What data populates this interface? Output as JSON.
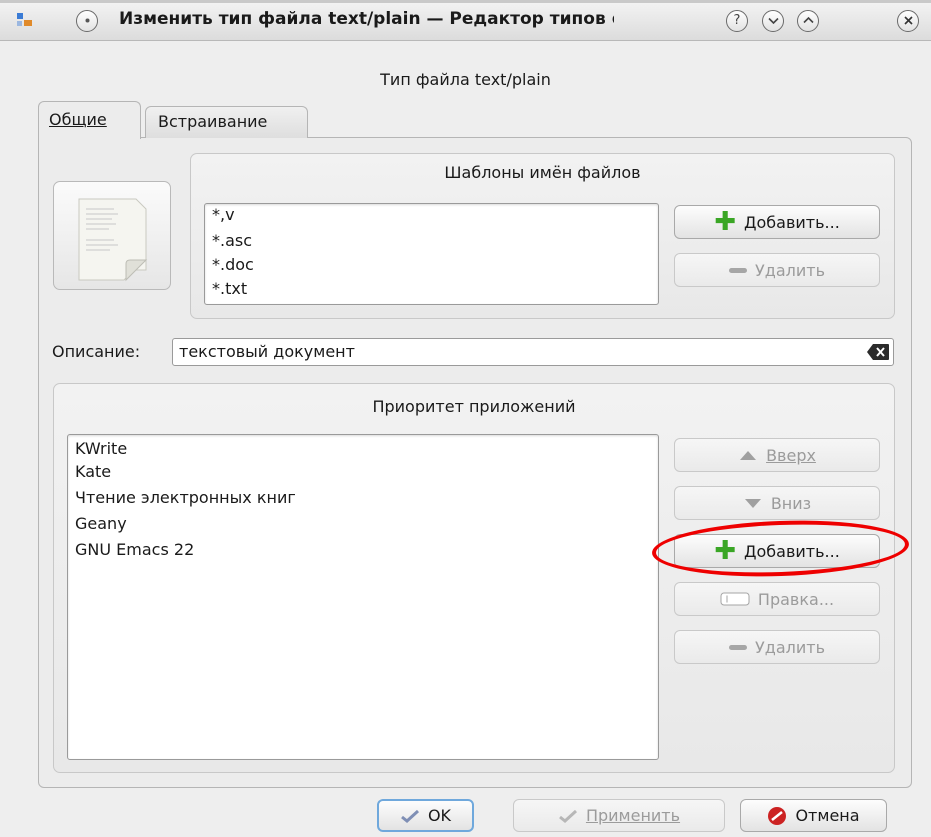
{
  "window": {
    "title": "Изменить тип файла text/plain — Редактор типов файлов",
    "close_icon": "close-icon",
    "help_icon": "help-icon",
    "minimize_icon": "chevron-down-icon",
    "maximize_icon": "chevron-up-icon"
  },
  "header": {
    "file_type_label": "Тип файла text/plain"
  },
  "tabs": [
    {
      "label": "Общие",
      "mnemonic": "О",
      "active": true
    },
    {
      "label": "Встраивание",
      "mnemonic": "В",
      "active": false
    }
  ],
  "patterns": {
    "title": "Шаблоны имён файлов",
    "items": [
      "*,v",
      "*.asc",
      "*.doc",
      "*.txt"
    ],
    "add_label": "Добавить...",
    "remove_label": "Удалить"
  },
  "description": {
    "label": "Описание:",
    "value": "текстовый документ"
  },
  "apps": {
    "title": "Приоритет приложений",
    "items": [
      "KWrite",
      "Kate",
      "Чтение электронных книг",
      "Geany",
      "GNU Emacs 22"
    ],
    "up_label": "Вверх",
    "down_label": "Вниз",
    "add_label": "Добавить...",
    "edit_label": "Правка...",
    "remove_label": "Удалить"
  },
  "buttons": {
    "ok_label": "OK",
    "apply_label": "Применить",
    "cancel_label": "Отмена"
  },
  "colors": {
    "annotation": "#ee0000",
    "add_icon": "#3aa625",
    "cancel_icon": "#cc2222"
  }
}
